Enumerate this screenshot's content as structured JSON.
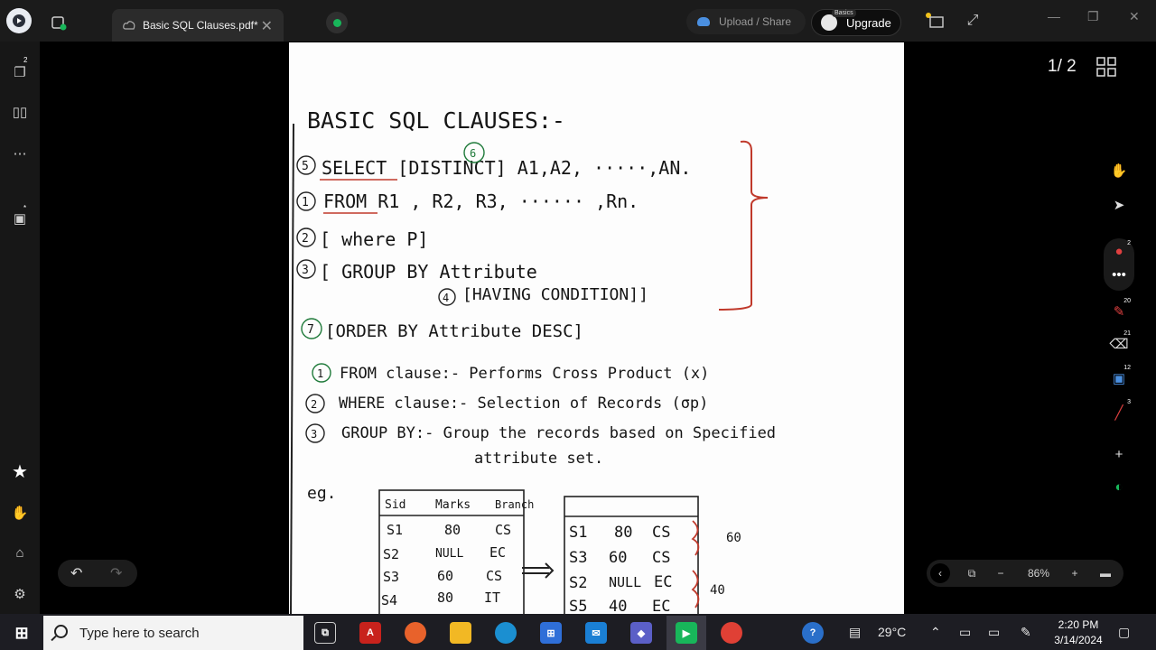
{
  "tab": {
    "title": "Basic SQL Clauses.pdf*"
  },
  "header": {
    "upload_label": "Upload / Share",
    "upgrade_label": "Upgrade",
    "upgrade_badge": "Basics"
  },
  "sidebar": {
    "pages_badge": "2",
    "bookmark_badge": "*"
  },
  "viewer": {
    "page_indicator": "1/ 2",
    "zoom": "86%"
  },
  "document": {
    "title": "BASIC SQL CLAUSES:-",
    "lines": [
      {
        "num": "5",
        "text": "SELECT [DISTINCT] A1,A2, ·····,AN."
      },
      {
        "num": "1",
        "text": "FROM  R1 , R2, R3, ······ ,Rn."
      },
      {
        "num": "2",
        "text": "[ where P]"
      },
      {
        "num": "3",
        "text": "[ GROUP  BY  Attribute"
      },
      {
        "num": "4",
        "text": "[HAVING CONDITION]]"
      },
      {
        "num": "7",
        "text": "[ORDER BY  Attribute  DESC]"
      }
    ],
    "distinct_num": "6",
    "notes": [
      {
        "num": "1",
        "text": "FROM clause:-  Performs Cross Product (x)"
      },
      {
        "num": "2",
        "text": "WHERE clause:- Selection of Records (σp)"
      },
      {
        "num": "3",
        "text": "GROUP BY:-  Group the records based on Specified"
      },
      {
        "num": "",
        "text": "attribute set."
      }
    ],
    "eg": "eg.",
    "table1": {
      "headers": [
        "Sid",
        "Marks",
        "Branch"
      ],
      "rows": [
        [
          "S1",
          "80",
          "CS"
        ],
        [
          "S2",
          "NULL",
          "EC"
        ],
        [
          "S3",
          "60",
          "CS"
        ],
        [
          "S4",
          "80",
          "IT"
        ]
      ]
    },
    "table2": {
      "rows": [
        [
          "S1",
          "80",
          "CS"
        ],
        [
          "S3",
          "60",
          "CS"
        ],
        [
          "S2",
          "NULL",
          "EC"
        ],
        [
          "S5",
          "40",
          "EC"
        ]
      ]
    },
    "group_labels": [
      "60",
      "40"
    ]
  },
  "right_tools": {
    "badges": [
      "2",
      "20",
      "21",
      "12",
      "3"
    ]
  },
  "taskbar": {
    "search_placeholder": "Type here to search",
    "temperature": "29°C",
    "time": "2:20 PM",
    "date": "3/14/2024"
  }
}
